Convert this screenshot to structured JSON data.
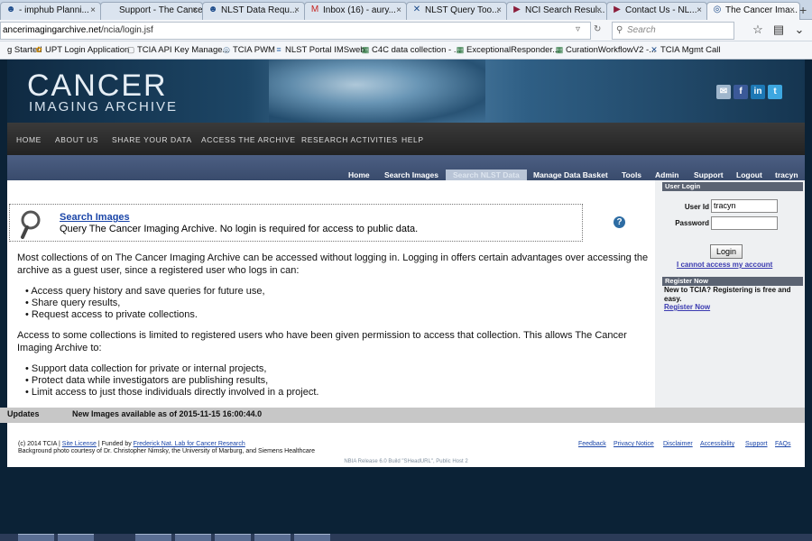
{
  "browser": {
    "tabs": [
      {
        "label": "- imphub Planni...",
        "icon": "people-icon",
        "active": false
      },
      {
        "label": "Support - The Cance...",
        "icon": "page-icon",
        "active": false
      },
      {
        "label": "NLST Data Requ...",
        "icon": "people-icon",
        "active": false
      },
      {
        "label": "Inbox (16) - aury...",
        "icon": "gmail-icon",
        "active": false
      },
      {
        "label": "NLST Query Too...",
        "icon": "tool-icon",
        "active": false
      },
      {
        "label": "NCI Search Resul...",
        "icon": "video-icon",
        "active": false
      },
      {
        "label": "Contact Us - NL...",
        "icon": "video-icon",
        "active": false
      },
      {
        "label": "The Cancer Ima...",
        "icon": "globe-icon",
        "active": true
      }
    ],
    "url_host": "ancerimagingarchive.net",
    "url_path": "/ncia/login.jsf",
    "search_placeholder": "Search",
    "bookmarks": [
      {
        "label": "g Started",
        "icon": ""
      },
      {
        "label": "UPT Login Application",
        "icon": "flower-icon"
      },
      {
        "label": "TCIA API Key Manage...",
        "icon": "page-icon"
      },
      {
        "label": "TCIA PWM",
        "icon": "globe-icon"
      },
      {
        "label": "NLST Portal IMSweb",
        "icon": "list-icon"
      },
      {
        "label": "C4C data collection - ...",
        "icon": "sheet-icon"
      },
      {
        "label": "ExceptionalResponder...",
        "icon": "sheet-icon"
      },
      {
        "label": "CurationWorkflowV2 -...",
        "icon": "sheet-icon"
      },
      {
        "label": "TCIA Mgmt Call",
        "icon": "tool-icon"
      }
    ]
  },
  "site": {
    "logo_main": "CANCER",
    "logo_sub": "IMAGING ARCHIVE",
    "top_nav": [
      "HOME",
      "ABOUT US",
      "SHARE YOUR DATA",
      "ACCESS THE ARCHIVE",
      "RESEARCH ACTIVITIES",
      "HELP"
    ],
    "sub_nav": [
      "Home",
      "Search Images",
      "Search NLST Data",
      "Manage Data Basket",
      "Tools",
      "Admin",
      "Support",
      "Logout",
      "tracyn"
    ],
    "sub_nav_selected": "Search NLST Data"
  },
  "main": {
    "search_title": "Search Images",
    "search_desc": "Query The Cancer Imaging Archive. No login is required for access to public data.",
    "para1": "Most collections of on The Cancer Imaging Archive can be accessed without logging in. Logging in offers certain advantages over accessing the archive as a guest user, since a registered user who logs in can:",
    "list1": [
      "Access query history and save queries for future use,",
      "Share query results,",
      "Request access to private collections."
    ],
    "para2": "Access to some collections is limited to registered users who have been given permission to access that collection. This allows The Cancer Imaging Archive to:",
    "list2": [
      "Support data collection for private or internal projects,",
      "Protect data while investigators are publishing results,",
      "Limit access to just those individuals directly involved in a project."
    ]
  },
  "login": {
    "header": "User Login",
    "userid_label": "User Id",
    "userid_value": "tracyn",
    "password_label": "Password",
    "password_value": "",
    "button": "Login",
    "cant_access": "I cannot access my account"
  },
  "register": {
    "header": "Register Now",
    "text": "New to TCIA? Registering is free and easy.",
    "link": "Register Now"
  },
  "updates": {
    "label": "Updates",
    "text": "New Images available as of 2015-11-15 16:00:44.0"
  },
  "footer": {
    "copyright": "(c) 2014 TCIA |",
    "site_license": "Site License",
    "funded_by": "| Funded by",
    "fnl": "Frederick Nat. Lab for Cancer Research",
    "photo_credit": "Background photo courtesy of Dr. Christopher Nimsky, the University of Marburg, and Siemens Healthcare",
    "links": [
      "Feedback",
      "Privacy Notice",
      "Disclaimer",
      "Accessibility",
      "Support",
      "FAQs"
    ],
    "release": "NBIA Release 6.0 Build \"SHeadURL\", Public Host 2"
  },
  "colors": {
    "banner_dark": "#0f2a42",
    "subnav": "#4c5f83",
    "link": "#1a45a8"
  }
}
